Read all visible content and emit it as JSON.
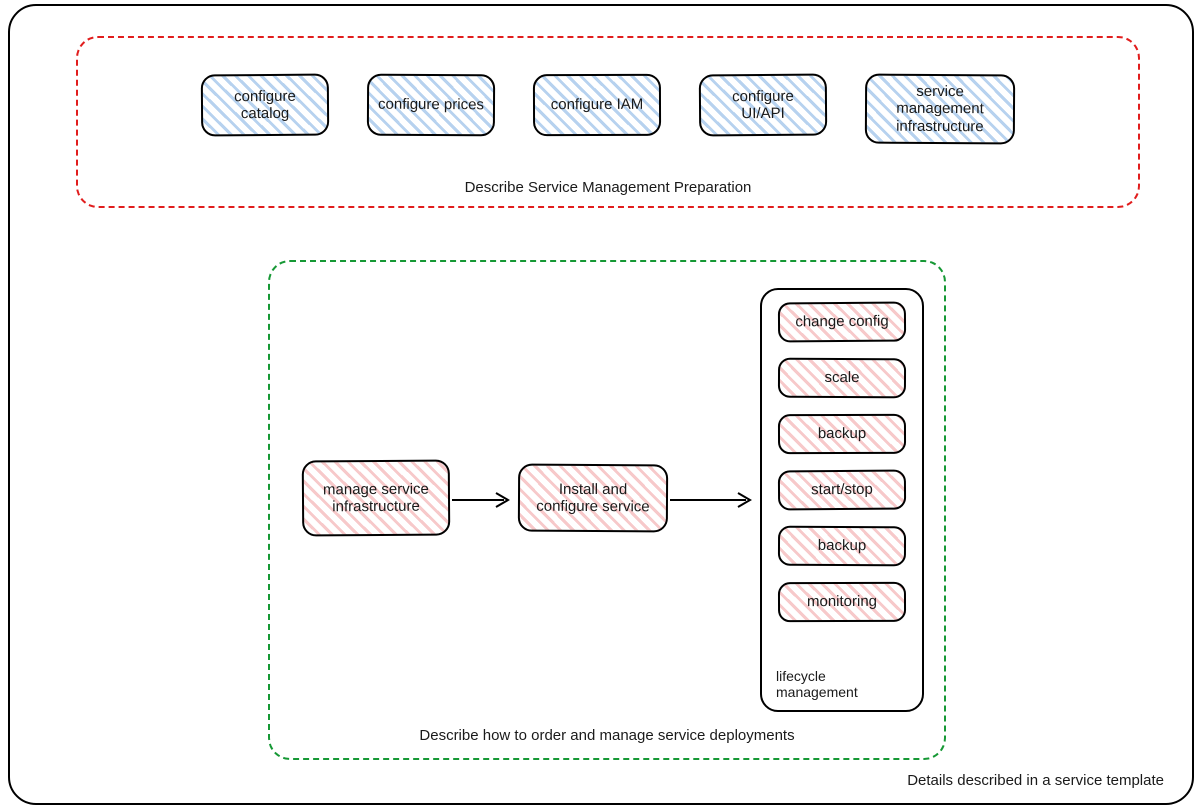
{
  "outer_caption": "Details described in a service template",
  "group_red": {
    "caption": "Describe Service Management Preparation",
    "items": [
      "configure catalog",
      "configure prices",
      "configure IAM",
      "configure UI/API",
      "service management infrastructure"
    ]
  },
  "group_green": {
    "caption": "Describe how to order and manage service deployments",
    "step1": "manage service infrastructure",
    "step2": "Install and configure service",
    "lifecycle_caption": "lifecycle management",
    "lifecycle_items": [
      "change config",
      "scale",
      "backup",
      "start/stop",
      "backup",
      "monitoring"
    ]
  }
}
